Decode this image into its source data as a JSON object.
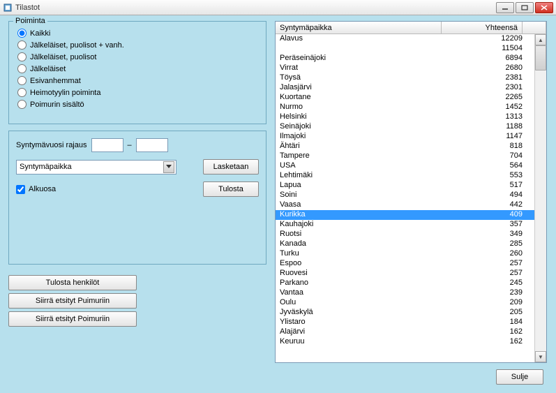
{
  "window": {
    "title": "Tilastot"
  },
  "group": {
    "legend": "Poiminta",
    "options": [
      "Kaikki",
      "Jälkeläiset, puolisot + vanh.",
      "Jälkeläiset, puolisot",
      "Jälkeläiset",
      "Esivanhemmat",
      "Heimotyylin poiminta",
      "Poimurin sisältö"
    ],
    "selected": 0
  },
  "filters": {
    "birth_year_label": "Syntymävuosi rajaus",
    "year_from": "",
    "year_to": "",
    "dash": "–",
    "combo_value": "Syntymäpaikka",
    "compute_label": "Lasketaan",
    "print_label": "Tulosta",
    "alkuosa_label": "Alkuosa",
    "alkuosa_checked": true
  },
  "actions": {
    "print_persons": "Tulosta henkilöt",
    "move_puimuri": "Siirrä etsityt Puimuriin",
    "move_poimuri": "Siirrä etsityt Poimuriin"
  },
  "list": {
    "col_place": "Syntymäpaikka",
    "col_total": "Yhteensä",
    "selected_index": 17,
    "rows": [
      {
        "place": "Alavus",
        "total": "12209"
      },
      {
        "place": "",
        "total": "11504"
      },
      {
        "place": "Peräseinäjoki",
        "total": "6894"
      },
      {
        "place": "Virrat",
        "total": "2680"
      },
      {
        "place": "Töysä",
        "total": "2381"
      },
      {
        "place": "Jalasjärvi",
        "total": "2301"
      },
      {
        "place": "Kuortane",
        "total": "2265"
      },
      {
        "place": "Nurmo",
        "total": "1452"
      },
      {
        "place": "Helsinki",
        "total": "1313"
      },
      {
        "place": "Seinäjoki",
        "total": "1188"
      },
      {
        "place": "Ilmajoki",
        "total": "1147"
      },
      {
        "place": "Ähtäri",
        "total": "818"
      },
      {
        "place": "Tampere",
        "total": "704"
      },
      {
        "place": "USA",
        "total": "564"
      },
      {
        "place": "Lehtimäki",
        "total": "553"
      },
      {
        "place": "Lapua",
        "total": "517"
      },
      {
        "place": "Soini",
        "total": "494"
      },
      {
        "place": "Vaasa",
        "total": "442"
      },
      {
        "place": "Kurikka",
        "total": "409"
      },
      {
        "place": "Kauhajoki",
        "total": "357"
      },
      {
        "place": "Ruotsi",
        "total": "349"
      },
      {
        "place": "Kanada",
        "total": "285"
      },
      {
        "place": "Turku",
        "total": "260"
      },
      {
        "place": "Espoo",
        "total": "257"
      },
      {
        "place": "Ruovesi",
        "total": "257"
      },
      {
        "place": "Parkano",
        "total": "245"
      },
      {
        "place": "Vantaa",
        "total": "239"
      },
      {
        "place": "Oulu",
        "total": "209"
      },
      {
        "place": "Jyväskylä",
        "total": "205"
      },
      {
        "place": "Ylistaro",
        "total": "184"
      },
      {
        "place": "Alajärvi",
        "total": "162"
      },
      {
        "place": "Keuruu",
        "total": "162"
      }
    ]
  },
  "close_label": "Sulje"
}
